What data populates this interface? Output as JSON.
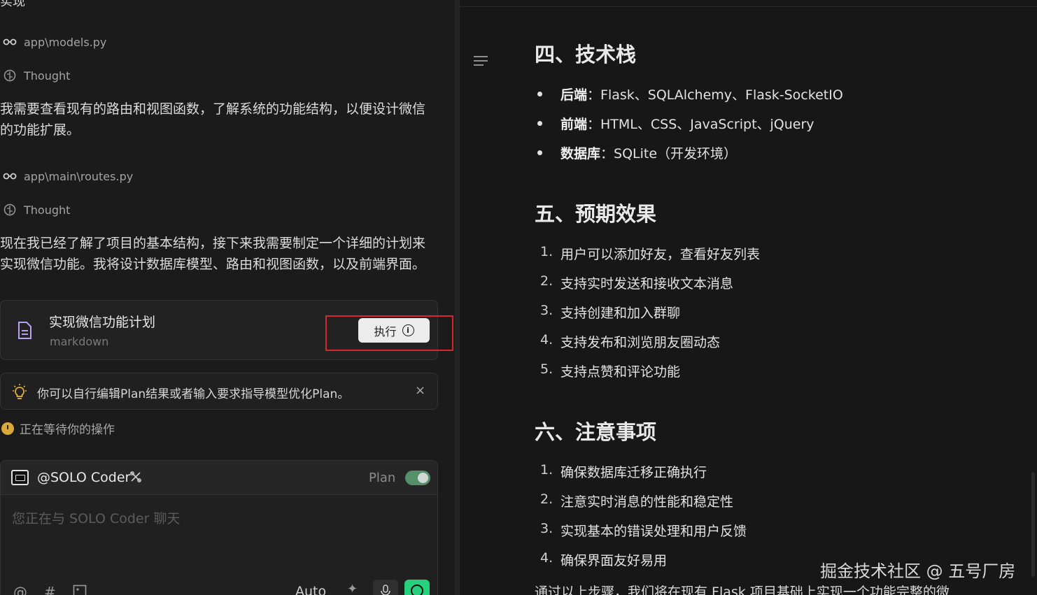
{
  "left": {
    "top_cut": "实现",
    "tool1": {
      "label": "app\\models.py",
      "icon": "glasses-icon"
    },
    "thought1": "Thought",
    "para1": [
      "我需要查看现有的路由和视图函数，了解系统的功能结构，以便设计微信",
      "的功能扩展。"
    ],
    "tool2": {
      "label": "app\\main\\routes.py",
      "icon": "glasses-icon"
    },
    "thought2": "Thought",
    "para2": [
      "现在我已经了解了项目的基本结构，接下来我需要制定一个详细的计划来",
      "实现微信功能。我将设计数据库模型、路由和视图函数，以及前端界面。"
    ],
    "plan_card": {
      "title": "实现微信功能计划",
      "subtitle": "markdown",
      "run_label": "执行",
      "run_icon": "info-icon"
    },
    "tip": {
      "text": "你可以自行编辑Plan结果或者输入要求指导模型优化Plan。",
      "close": "×"
    },
    "waiting": "正在等待你的操作",
    "chat": {
      "agent_name": "@SOLO Coder",
      "plan_label": "Plan",
      "plan_enabled": true,
      "placeholder": "您正在与 SOLO Coder 聊天",
      "at_symbol": "@",
      "hash_symbol": "#",
      "auto_label": "Auto",
      "accent_send": "#26d07c"
    }
  },
  "right": {
    "h_tech": "四、技术栈",
    "tech": [
      {
        "key": "后端",
        "value": "：Flask、SQLAlchemy、Flask-SocketIO"
      },
      {
        "key": "前端",
        "value": "：HTML、CSS、JavaScript、jQuery"
      },
      {
        "key": "数据库",
        "value": "：SQLite（开发环境）"
      }
    ],
    "h_effect": "五、预期效果",
    "effects": [
      {
        "n": "1.",
        "t": "用户可以添加好友，查看好友列表"
      },
      {
        "n": "2.",
        "t": "支持实时发送和接收文本消息"
      },
      {
        "n": "3.",
        "t": "支持创建和加入群聊"
      },
      {
        "n": "4.",
        "t": "支持发布和浏览朋友圈动态"
      },
      {
        "n": "5.",
        "t": "支持点赞和评论功能"
      }
    ],
    "h_notes": "六、注意事项",
    "notes": [
      {
        "n": "1.",
        "t": "确保数据库迁移正确执行"
      },
      {
        "n": "2.",
        "t": "注意实时消息的性能和稳定性"
      },
      {
        "n": "3.",
        "t": "实现基本的错误处理和用户反馈"
      },
      {
        "n": "4.",
        "t": "确保界面友好易用"
      }
    ],
    "bottom_cut": "通过以上步骤，我们将在现有 Flask 项目基础上实现一个功能完整的微",
    "watermark": "掘金技术社区 @ 五号厂房"
  }
}
